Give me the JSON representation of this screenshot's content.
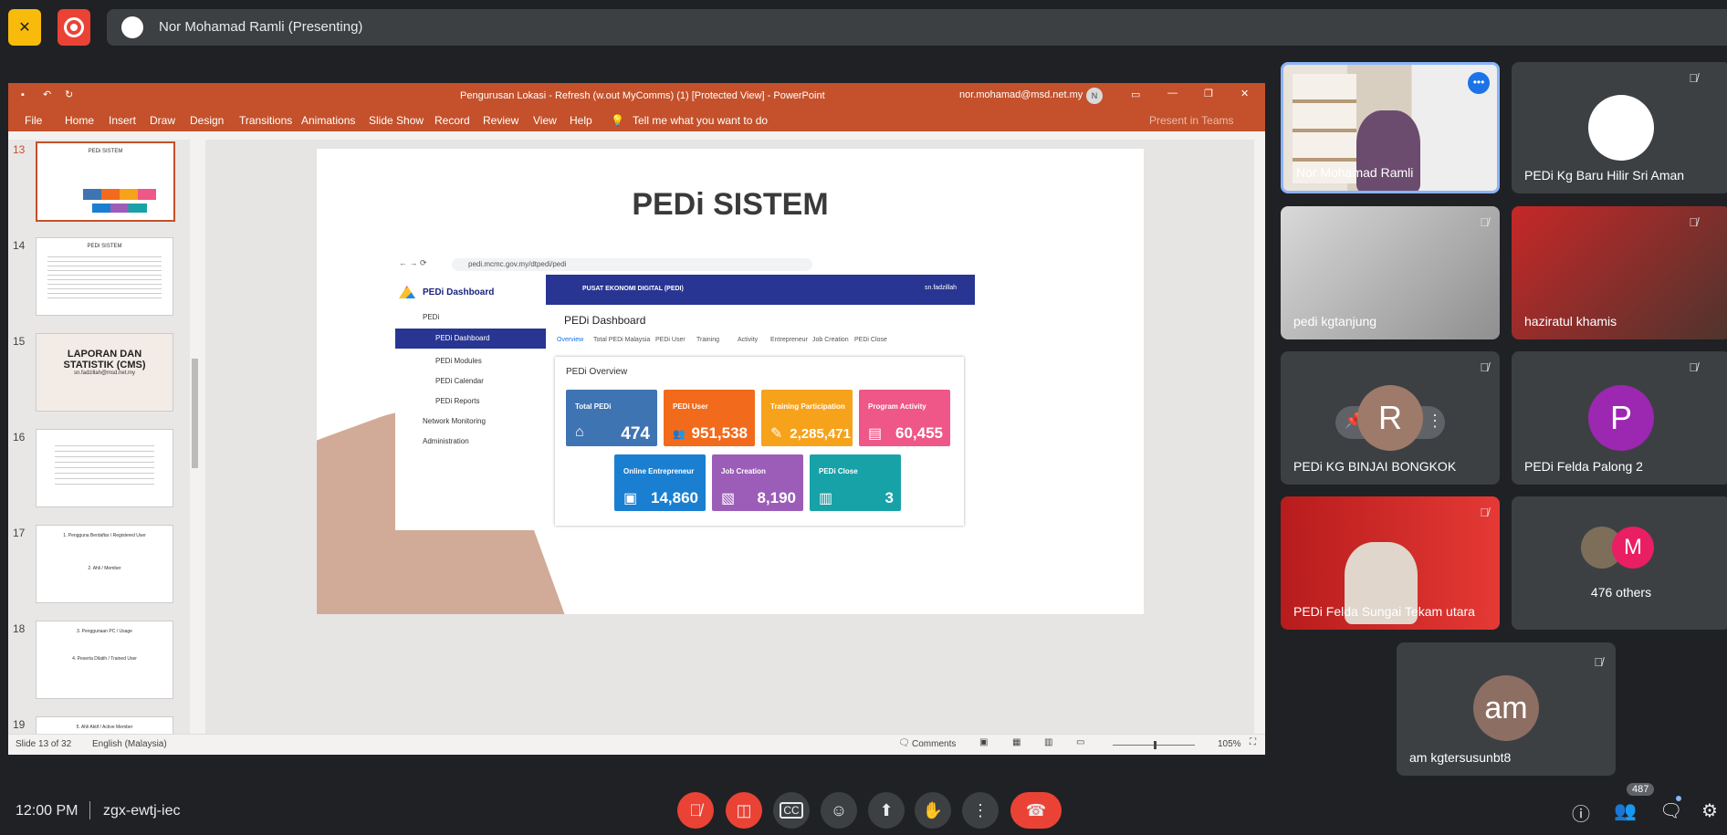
{
  "presenter": {
    "banner": "Nor Mohamad Ramli (Presenting)"
  },
  "ppt": {
    "title": "Pengurusan Lokasi - Refresh (w.out MyComms) (1) [Protected View]  -  PowerPoint",
    "account": "nor.mohamad@msd.net.my",
    "account_initials": "N",
    "menu": [
      "File",
      "Home",
      "Insert",
      "Draw",
      "Design",
      "Transitions",
      "Animations",
      "Slide Show",
      "Record",
      "Review",
      "View",
      "Help"
    ],
    "tell_me": "Tell me what you want to do",
    "present_in_teams": "Present in Teams",
    "thumbs": [
      {
        "num": "13",
        "title": "PEDi SISTEM"
      },
      {
        "num": "14",
        "title": "PEDI SISTEM"
      },
      {
        "num": "15",
        "title": "LAPORAN DAN STATISTIK (CMS)",
        "sub": "sn.fadzillah@msd.net.my"
      },
      {
        "num": "16",
        "title": ""
      },
      {
        "num": "17",
        "title": "1. Pengguna Berdaftar / Registered User",
        "title2": "2. Ahli / Member"
      },
      {
        "num": "18",
        "title": "3. Penggunaan PC / Usage",
        "title2": "4. Peserta Dilatih / Trained User"
      },
      {
        "num": "19",
        "title": "5. Ahli Aktif / Active Member"
      }
    ],
    "status": {
      "slide": "Slide 13 of 32",
      "lang": "English (Malaysia)",
      "comments": "Comments",
      "zoom": "105%"
    }
  },
  "slide": {
    "title": "PEDi SISTEM",
    "url": "pedi.mcmc.gov.my/dtpedi/pedi",
    "brand": "PEDi Dashboard",
    "header_text": "PUSAT EKONOMI DIGITAL (PEDI)",
    "user": "sn.fadzillah",
    "nav": [
      {
        "label": "PEDi"
      },
      {
        "label": "PEDi Dashboard"
      },
      {
        "label": "PEDi Modules"
      },
      {
        "label": "PEDi Calendar"
      },
      {
        "label": "PEDi Reports"
      },
      {
        "label": "Network Monitoring"
      },
      {
        "label": "Administration"
      }
    ],
    "page_title": "PEDi Dashboard",
    "tabs": [
      "Overview",
      "Total PEDi Malaysia",
      "PEDi User",
      "Training",
      "Activity",
      "Entrepreneur",
      "Job Creation",
      "PEDi Close"
    ],
    "overview_title": "PEDi Overview",
    "cards": [
      {
        "title": "Total PEDi",
        "value": "474",
        "color": "#3f74b3",
        "icon": "home-icon",
        "glyph": "⌂"
      },
      {
        "title": "PEDi User",
        "value": "951,538",
        "color": "#f26a1b",
        "icon": "users-icon",
        "glyph": "👥"
      },
      {
        "title": "Training Participation",
        "value": "2,285,471",
        "color": "#f7a21b",
        "icon": "pencil-icon",
        "glyph": "✎"
      },
      {
        "title": "Program Activity",
        "value": "60,455",
        "color": "#ee5788",
        "icon": "document-icon",
        "glyph": "▤"
      },
      {
        "title": "Online Entrepreneur",
        "value": "14,860",
        "color": "#1a7fd1",
        "icon": "briefcase-icon",
        "glyph": "▣"
      },
      {
        "title": "Job Creation",
        "value": "8,190",
        "color": "#9b5db7",
        "icon": "note-add-icon",
        "glyph": "▧"
      },
      {
        "title": "PEDi Close",
        "value": "3",
        "color": "#17a2a8",
        "icon": "store-icon",
        "glyph": "▥"
      }
    ]
  },
  "participants": [
    {
      "name": "Nor Mohamad Ramli"
    },
    {
      "name": "PEDi Kg Baru Hilir Sri Aman"
    },
    {
      "name": "pedi kgtanjung"
    },
    {
      "name": "haziratul khamis"
    },
    {
      "name": "PEDi KG BINJAI BONGKOK",
      "initial": "R"
    },
    {
      "name": "PEDi Felda Palong 2",
      "initial": "P"
    },
    {
      "name": "PEDi Felda Sungai Tekam utara"
    },
    {
      "name": "476 others",
      "initial": "M"
    },
    {
      "name": "am kgtersusunbt8",
      "initial": "am"
    }
  ],
  "meeting": {
    "time": "12:00 PM",
    "code": "zgx-ewtj-iec",
    "people_count": "487"
  }
}
